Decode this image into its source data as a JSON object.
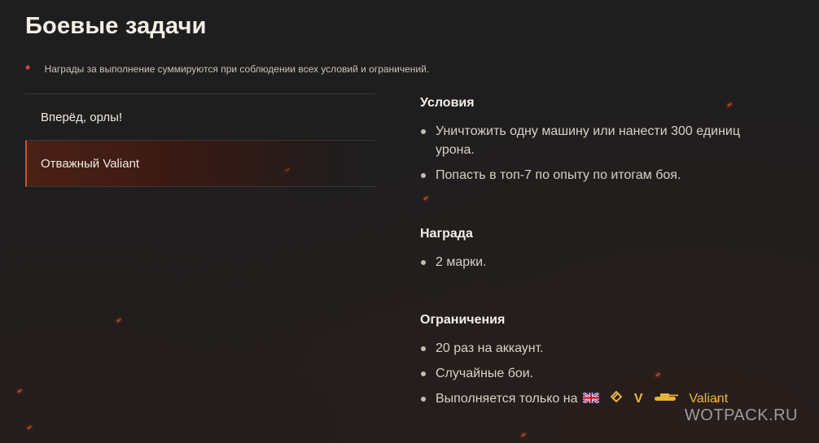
{
  "title": "Боевые задачи",
  "note": {
    "asterisk": "*",
    "text": "Награды за выполнение суммируются при соблюдении всех условий и ограничений."
  },
  "missions": [
    {
      "label": "Вперёд, орлы!",
      "active": false
    },
    {
      "label": "Отважный Valiant",
      "active": true
    }
  ],
  "details": {
    "conditions": {
      "title": "Условия",
      "items": [
        "Уничтожить одну машину или нанести 300 единиц урона.",
        "Попасть в топ-7 по опыту по итогам боя."
      ]
    },
    "reward": {
      "title": "Награда",
      "items": [
        "2 марки."
      ]
    },
    "limits": {
      "title": "Ограничения",
      "items": [
        "20 раз на аккаунт.",
        "Случайные бои."
      ],
      "vehicle_line": {
        "prefix": "Выполняется только на",
        "flag_icon": "uk-flag-icon",
        "class_icon": "tank-destroyer-class-icon",
        "tier": "V",
        "tank_icon": "tank-silhouette-icon",
        "tank_name": "Valiant"
      }
    }
  },
  "watermark": "WOTPACK.RU",
  "colors": {
    "accent": "#c9512c",
    "gold": "#f0b93a",
    "background": "#1f1e1f"
  }
}
